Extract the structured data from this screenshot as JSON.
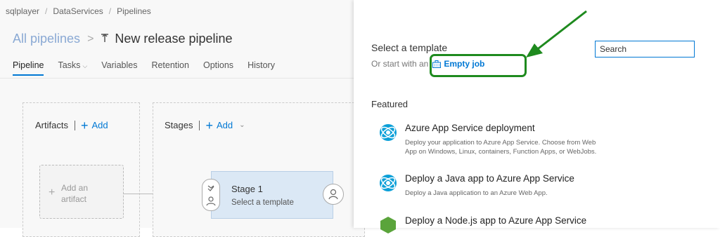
{
  "breadcrumb": {
    "org": "sqlplayer",
    "project": "DataServices",
    "section": "Pipelines",
    "sep": "/"
  },
  "header": {
    "all_pipelines": "All pipelines",
    "chevron": ">",
    "pipeline_name": "New release pipeline"
  },
  "tabs": [
    {
      "label": "Pipeline"
    },
    {
      "label": "Tasks"
    },
    {
      "label": "Variables"
    },
    {
      "label": "Retention"
    },
    {
      "label": "Options"
    },
    {
      "label": "History"
    }
  ],
  "artifacts": {
    "label": "Artifacts",
    "add": "Add",
    "card_line1": "Add an",
    "card_line2": "artifact"
  },
  "stages": {
    "label": "Stages",
    "add": "Add",
    "stage_name": "Stage 1",
    "stage_sub": "Select a template"
  },
  "panel": {
    "title": "Select a template",
    "subtitle": "Or start with an",
    "empty_job": "Empty job",
    "search_placeholder": "Search",
    "featured_label": "Featured",
    "templates": [
      {
        "title": "Azure App Service deployment",
        "desc": "Deploy your application to Azure App Service. Choose from Web App on Windows, Linux, containers, Function Apps, or WebJobs.",
        "icon": "azure-app-service-icon"
      },
      {
        "title": "Deploy a Java app to Azure App Service",
        "desc": "Deploy a Java application to an Azure Web App.",
        "icon": "azure-app-service-icon"
      },
      {
        "title": "Deploy a Node.js app to Azure App Service",
        "desc": "",
        "icon": "nodejs-icon"
      }
    ]
  },
  "colors": {
    "accent": "#0078d4",
    "highlight": "#1e8a1e",
    "stage_bg": "#dbe8f5"
  }
}
